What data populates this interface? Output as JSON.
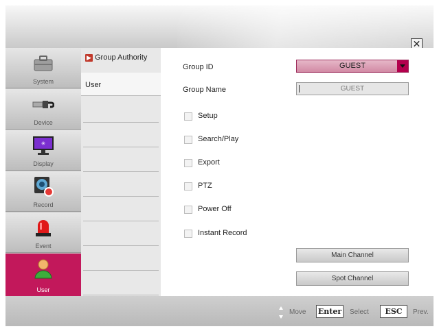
{
  "header": {
    "close_glyph": "✕"
  },
  "nav": {
    "items": [
      {
        "label": "System",
        "icon": "briefcase-icon"
      },
      {
        "label": "Device",
        "icon": "plug-icon"
      },
      {
        "label": "Display",
        "icon": "monitor-icon"
      },
      {
        "label": "Record",
        "icon": "camera-record-icon"
      },
      {
        "label": "Event",
        "icon": "alarm-light-icon"
      },
      {
        "label": "User",
        "icon": "user-icon",
        "active": true
      }
    ],
    "active_color": "#c2185b"
  },
  "sub": {
    "header_label": "Group Authority",
    "header_arrow": "▶",
    "items": [
      {
        "label": "User"
      }
    ]
  },
  "form": {
    "group_id_label": "Group ID",
    "group_id_value": "GUEST",
    "group_name_label": "Group Name",
    "group_name_value": "GUEST",
    "permissions": [
      {
        "label": "Setup",
        "checked": false
      },
      {
        "label": "Search/Play",
        "checked": false
      },
      {
        "label": "Export",
        "checked": false
      },
      {
        "label": "PTZ",
        "checked": false
      },
      {
        "label": "Power Off",
        "checked": false
      },
      {
        "label": "Instant Record",
        "checked": false
      }
    ],
    "main_channel_label": "Main Channel",
    "spot_channel_label": "Spot  Channel"
  },
  "footer": {
    "move_label": "Move",
    "enter_key": "Enter",
    "select_label": "Select",
    "esc_key": "ESC",
    "prev_label": "Prev."
  }
}
